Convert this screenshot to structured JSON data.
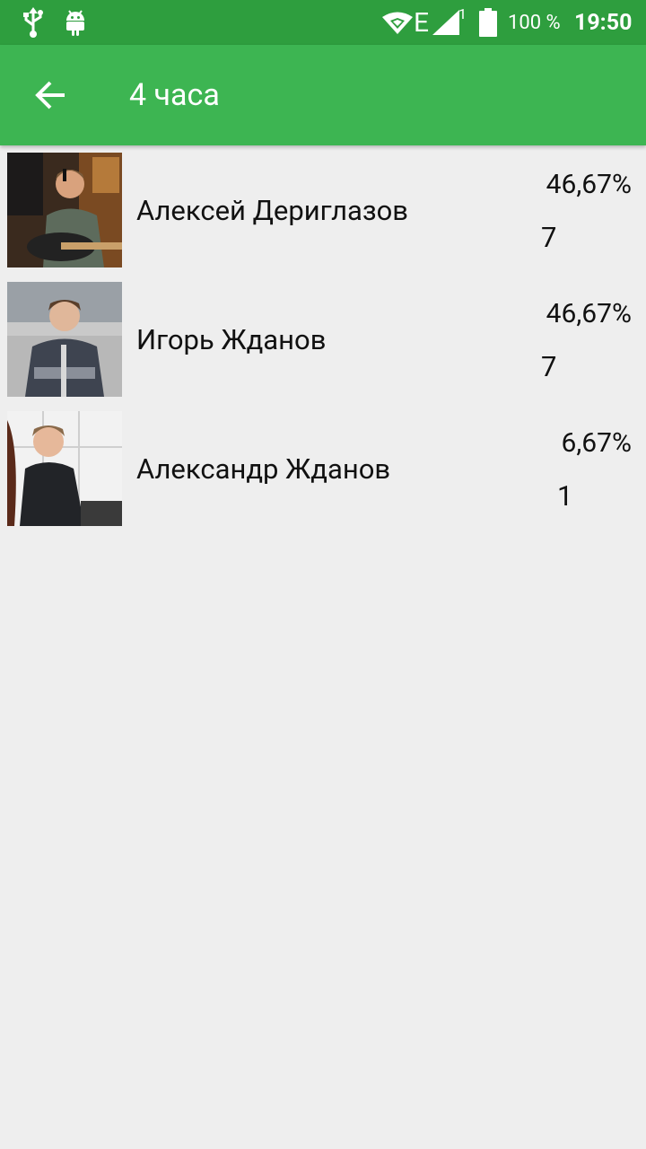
{
  "status_bar": {
    "battery": "100 %",
    "time": "19:50",
    "network": "E",
    "sim": "1"
  },
  "toolbar": {
    "title": "4 часа"
  },
  "results": [
    {
      "name": "Алексей Дериглазов",
      "percent": "46,67%",
      "votes": "7"
    },
    {
      "name": "Игорь Жданов",
      "percent": "46,67%",
      "votes": "7"
    },
    {
      "name": "Александр Жданов",
      "percent": "6,67%",
      "votes": "1"
    }
  ],
  "colors": {
    "status_bar": "#2e9e3e",
    "app_bar": "#3db552",
    "background": "#eeeeee"
  }
}
